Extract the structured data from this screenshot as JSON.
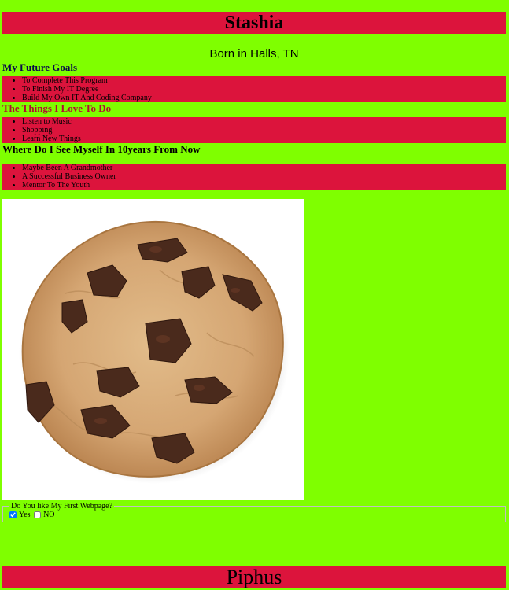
{
  "header": {
    "title": "Stashia",
    "subtitle": "Born in Halls, TN"
  },
  "goals": {
    "heading": "My Future Goals",
    "items": [
      "To Complete This Program",
      "To Finish My IT Degree",
      "Build My Own IT And Coding Company"
    ]
  },
  "loves": {
    "heading": "The Things I Love To Do",
    "items": [
      "Listen to Music",
      "Shopping",
      "Learn New Things"
    ]
  },
  "future": {
    "heading": "Where Do I See Myself In 10years From Now",
    "items": [
      "Maybe Been A Grandmother",
      "A Successful Business Owner",
      "Mentor To The Youth"
    ]
  },
  "image": {
    "alt": "chocolate-chip-cookie"
  },
  "poll": {
    "legend": "Do You like My First Webpage?",
    "options": [
      {
        "label": "Yes",
        "checked": true
      },
      {
        "label": "NO",
        "checked": false
      }
    ]
  },
  "footer": {
    "text": "Piphus"
  },
  "colors": {
    "background": "#7fff00",
    "accent": "#dc143c"
  }
}
